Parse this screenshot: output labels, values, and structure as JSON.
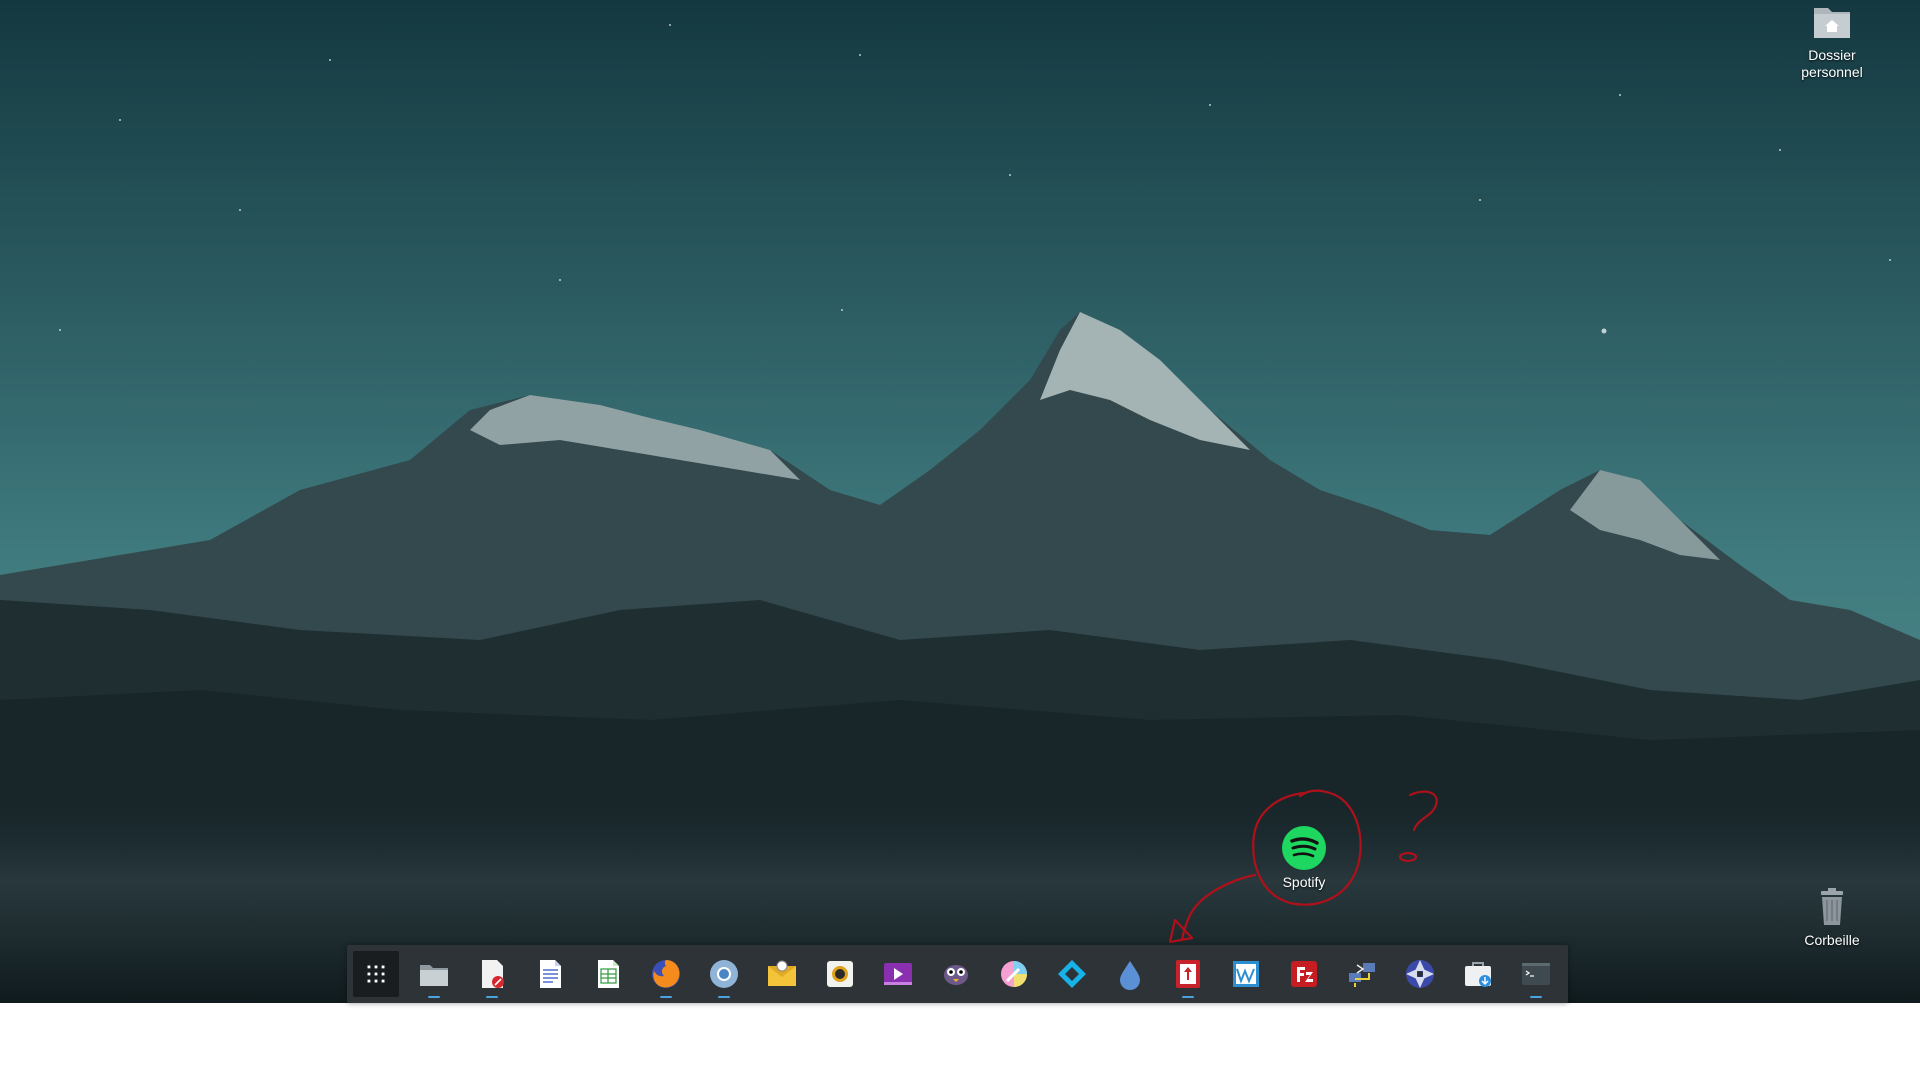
{
  "desktop": {
    "icons": [
      {
        "label": "Dossier personnel",
        "icon": "home-folder-icon"
      },
      {
        "label": "Corbeille",
        "icon": "trash-icon"
      },
      {
        "label": "Spotify",
        "icon": "spotify-icon"
      }
    ]
  },
  "dock": {
    "items": [
      {
        "icon": "app-grid-icon",
        "running": false
      },
      {
        "icon": "files-icon",
        "running": true
      },
      {
        "icon": "document-viewer-icon",
        "running": true
      },
      {
        "icon": "text-document-icon",
        "running": false
      },
      {
        "icon": "spreadsheet-icon",
        "running": false
      },
      {
        "icon": "firefox-icon",
        "running": true
      },
      {
        "icon": "chromium-icon",
        "running": true
      },
      {
        "icon": "mail-icon",
        "running": false
      },
      {
        "icon": "music-player-icon",
        "running": false
      },
      {
        "icon": "video-player-icon",
        "running": false
      },
      {
        "icon": "pidgin-icon",
        "running": false
      },
      {
        "icon": "color-picker-icon",
        "running": false
      },
      {
        "icon": "kodi-icon",
        "running": false
      },
      {
        "icon": "drop-icon",
        "running": false
      },
      {
        "icon": "transmission-icon",
        "running": true
      },
      {
        "icon": "system-monitor-icon",
        "running": false
      },
      {
        "icon": "filezilla-icon",
        "running": false
      },
      {
        "icon": "network-icon",
        "running": false
      },
      {
        "icon": "aperture-icon",
        "running": false
      },
      {
        "icon": "software-center-icon",
        "running": false
      },
      {
        "icon": "terminal-icon",
        "running": true
      }
    ]
  },
  "colors": {
    "dock_bg": "#2e3338",
    "indicator": "#4aa3df",
    "annotation": "#b0101a",
    "spotify_green": "#1ed760"
  }
}
